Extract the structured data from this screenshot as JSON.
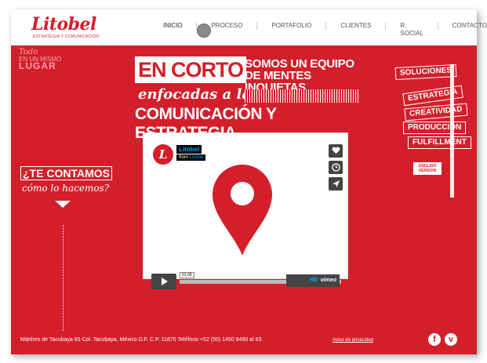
{
  "logo": {
    "name": "Litobel",
    "tagline": "ESTRATEGIA Y COMUNICACIÓN"
  },
  "nav": [
    "INICIO",
    "PROCESO",
    "PORTAFOLIO",
    "CLIENTES",
    "R. SOCIAL",
    "CONTACTO"
  ],
  "badge": {
    "line1": "Todo",
    "line2": "EN UN MISMO",
    "line3": "LUGAR"
  },
  "hero": {
    "box": "EN CORTO",
    "line1": "SOMOS UN EQUIPO",
    "line2": "DE MENTES INQUIETAS",
    "italic": "enfocadas a la",
    "bottom": "COMUNICACIÓN Y ESTRATEGIA"
  },
  "video": {
    "title": "Litobel",
    "from": "from",
    "user": "Litobel",
    "time": "01:09",
    "hd": "HD",
    "brand": "vimeo"
  },
  "cta": {
    "line1": "¿TE CONTAMOS",
    "line2": "cómo lo hacemos?"
  },
  "signs": [
    "SOLUCIONES",
    "ESTRATEGIA",
    "CREATIVIDAD",
    "PRODUCCIÓN",
    "FULFILLMENT"
  ],
  "english": {
    "line1": "ENGLISH",
    "line2": "VERSION"
  },
  "footer": {
    "address": "Mártires de Tacubaya 65 Col. Tacubaya, México D.F. C.P. 11870 Teléfono +52 (55) 1450 9460 al 63.",
    "privacy": "Aviso de privacidad"
  },
  "social": {
    "facebook": "f",
    "vimeo": "v"
  },
  "colors": {
    "brand": "#d31f2b",
    "accent": "#00adef"
  }
}
